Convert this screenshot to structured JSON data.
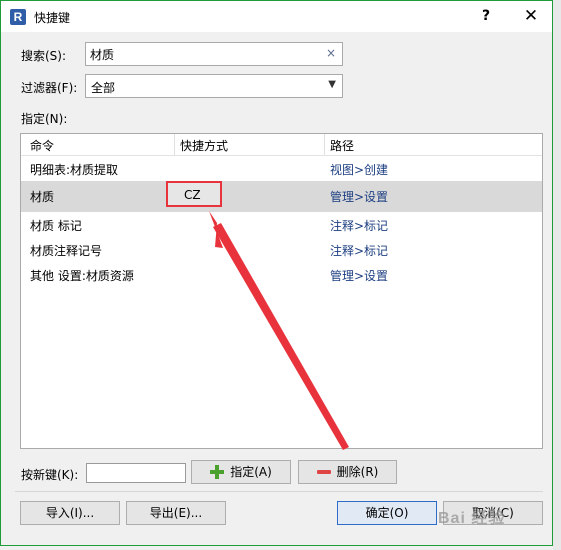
{
  "window": {
    "icon_letter": "R",
    "title": "快捷键",
    "help": "?",
    "close": "✕"
  },
  "search": {
    "label": "搜索(S):",
    "value": "材质",
    "clear": "×"
  },
  "filter": {
    "label": "过滤器(F):",
    "value": "全部"
  },
  "assign_label": "指定(N):",
  "table": {
    "columns": [
      "命令",
      "快捷方式",
      "路径"
    ],
    "rows": [
      {
        "command": "明细表:材质提取",
        "shortcut": "",
        "path": "视图>创建"
      },
      {
        "command": "材质",
        "shortcut": "CZ",
        "path": "管理>设置"
      },
      {
        "command": "材质 标记",
        "shortcut": "",
        "path": "注释>标记"
      },
      {
        "command": "材质注释记号",
        "shortcut": "",
        "path": "注释>标记"
      },
      {
        "command": "其他 设置:材质资源",
        "shortcut": "",
        "path": "管理>设置"
      }
    ],
    "selected_index": 1
  },
  "new_key": {
    "label": "按新键(K):",
    "value": ""
  },
  "buttons": {
    "assign": "指定(A)",
    "remove": "删除(R)",
    "import": "导入(I)...",
    "export": "导出(E)...",
    "ok": "确定(O)",
    "cancel": "取消(C)"
  },
  "watermark": "Bai 经验",
  "colors": {
    "highlight_border": "#e8323c",
    "arrow": "#e8323c",
    "path_text": "#1d3f82",
    "selected_row": "#d9d9d9"
  }
}
